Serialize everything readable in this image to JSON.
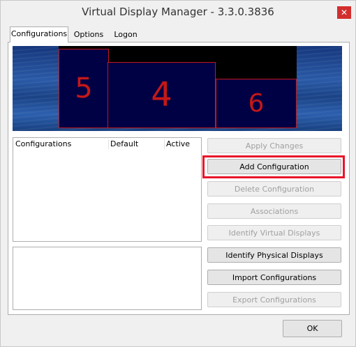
{
  "window": {
    "title": "Virtual Display Manager - 3.3.0.3836",
    "close_glyph": "✕"
  },
  "tabs": [
    {
      "label": "Configurations",
      "active": true
    },
    {
      "label": "Options",
      "active": false
    },
    {
      "label": "Logon",
      "active": false
    }
  ],
  "displays": [
    {
      "number": "5"
    },
    {
      "number": "4"
    },
    {
      "number": "6"
    }
  ],
  "config_list": {
    "columns": [
      "Configurations",
      "Default",
      "Active"
    ],
    "rows": []
  },
  "buttons": {
    "apply_changes": "Apply Changes",
    "add_configuration": "Add Configuration",
    "delete_configuration": "Delete Configuration",
    "associations": "Associations",
    "identify_virtual": "Identify Virtual Displays",
    "identify_physical": "Identify Physical Displays",
    "import_configurations": "Import Configurations",
    "export_configurations": "Export Configurations",
    "ok": "OK"
  },
  "colors": {
    "highlight": "#e8142a",
    "display_border": "#c41818",
    "display_fill": "#000044"
  }
}
